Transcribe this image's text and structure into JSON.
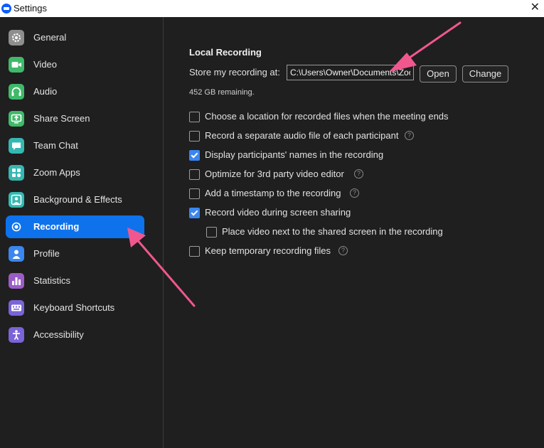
{
  "window": {
    "title": "Settings",
    "close_glyph": "✕"
  },
  "sidebar": {
    "items": [
      {
        "label": "General",
        "icon": "gear-icon",
        "color": "#8e8e8e"
      },
      {
        "label": "Video",
        "icon": "video-camera-icon",
        "color": "#3fba6a"
      },
      {
        "label": "Audio",
        "icon": "headphones-icon",
        "color": "#3fba6a"
      },
      {
        "label": "Share Screen",
        "icon": "share-screen-icon",
        "color": "#3fba6a"
      },
      {
        "label": "Team Chat",
        "icon": "chat-bubble-icon",
        "color": "#35b8b2"
      },
      {
        "label": "Zoom Apps",
        "icon": "apps-icon",
        "color": "#35b8b2"
      },
      {
        "label": "Background & Effects",
        "icon": "person-frame-icon",
        "color": "#35b8b2"
      },
      {
        "label": "Recording",
        "icon": "record-icon",
        "color": "#0e72ed"
      },
      {
        "label": "Profile",
        "icon": "person-icon",
        "color": "#3b86f0"
      },
      {
        "label": "Statistics",
        "icon": "bar-chart-icon",
        "color": "#9b5cc7"
      },
      {
        "label": "Keyboard Shortcuts",
        "icon": "keyboard-icon",
        "color": "#7b63d8"
      },
      {
        "label": "Accessibility",
        "icon": "accessibility-icon",
        "color": "#7b63d8"
      }
    ],
    "active": "Recording"
  },
  "recording": {
    "section_title": "Local Recording",
    "store_label": "Store my recording at:",
    "path_value": "C:\\Users\\Owner\\Documents\\Zoom",
    "open_label": "Open",
    "change_label": "Change",
    "remaining": "452 GB remaining.",
    "help_glyph": "?",
    "options": [
      {
        "label": "Choose a location for recorded files when the meeting ends",
        "checked": false,
        "help": false
      },
      {
        "label": "Record a separate audio file of each participant",
        "checked": false,
        "help": true
      },
      {
        "label": "Display participants' names in the recording",
        "checked": true,
        "help": false
      },
      {
        "label": "Optimize for 3rd party video editor",
        "checked": false,
        "help": true
      },
      {
        "label": "Add a timestamp to the recording",
        "checked": false,
        "help": true
      },
      {
        "label": "Record video during screen sharing",
        "checked": true,
        "help": false
      },
      {
        "label": "Place video next to the shared screen in the recording",
        "checked": false,
        "help": false
      },
      {
        "label": "Keep temporary recording files",
        "checked": false,
        "help": true
      }
    ]
  },
  "colors": {
    "accent": "#0e72ed",
    "annotation_arrow": "#f0578f",
    "background": "#1f1f1f"
  }
}
